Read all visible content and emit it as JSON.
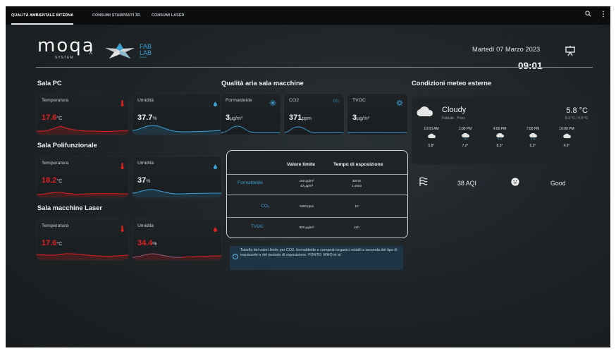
{
  "topbar": {
    "tabs": [
      {
        "label": "QUALITÀ AMBIENTALE INTERNA",
        "active": true
      },
      {
        "label": "CONSUMI STAMPANTI 3D",
        "active": false
      },
      {
        "label": "CONSUMI LASER",
        "active": false
      }
    ],
    "icons": [
      "search-icon",
      "more-vert-icon"
    ]
  },
  "header": {
    "logo_moqa": "moqa",
    "logo_system": "SYSTEM",
    "logo_x": "X",
    "fab_lab": "FAB\nLAB",
    "fab_sub": "trentino",
    "date": "Martedì 07 Marzo 2023",
    "time": "09:01"
  },
  "sala_pc": {
    "title": "Sala PC",
    "temperatura": {
      "label": "Temperatura",
      "value": "17.6",
      "unit": "°C"
    },
    "umidita": {
      "label": "Umidità",
      "value": "37.7",
      "unit": "%"
    }
  },
  "sala_polifunzionale": {
    "title": "Sala Polifunzionale",
    "temperatura": {
      "label": "Temperatura",
      "value": "18.2",
      "unit": "°C"
    },
    "umidita": {
      "label": "Umidità",
      "value": "37",
      "unit": "%"
    }
  },
  "sala_laser": {
    "title": "Sala macchine Laser",
    "temperatura": {
      "label": "Temperatura",
      "value": "17.6",
      "unit": "°C"
    },
    "umidita": {
      "label": "Umidità",
      "value": "34.4",
      "unit": "%"
    }
  },
  "aria": {
    "title": "Qualità aria sala macchine",
    "formaldeide": {
      "label": "Formaldeide",
      "value": "3",
      "unit": "μg/m³"
    },
    "co2": {
      "label": "CO2",
      "value": "371",
      "unit": "ppm",
      "badge": "CO₂"
    },
    "tvoc": {
      "label": "TVOC",
      "value": "3",
      "unit": "μg/m³"
    }
  },
  "limiti": {
    "header_valore": "Valore limite",
    "header_tempo": "Tempo di esposizione",
    "rows": [
      {
        "name": "Formaldeide",
        "valore1": "100 μg/m³",
        "valore2": "10 μg/m³",
        "tempo1": "30min",
        "tempo2": "1 anno"
      },
      {
        "name": "CO₂",
        "valore1": "1500 ppm",
        "tempo1": "1h"
      },
      {
        "name": "TVOC",
        "valore1": "600 μg/m³",
        "tempo1": "24h"
      }
    ],
    "note": "Tabella dei valori limite per CO2, formaldeide e composti organici volatili a seconda del tipo di inquinante e del periodo di esposizione. FONTE: WHO et al."
  },
  "meteo": {
    "title": "Condizioni meteo esterne",
    "condition": "Cloudy",
    "location": "FabLab - Povo",
    "temp": "5.8 °C",
    "range": "8.3 °C / 4.9 °C",
    "forecast": [
      {
        "time": "10:00 AM",
        "temp": "5.8°"
      },
      {
        "time": "1:00 PM",
        "temp": "7.2°"
      },
      {
        "time": "4:00 PM",
        "temp": "8.3°"
      },
      {
        "time": "7:00 PM",
        "temp": "6.3°"
      },
      {
        "time": "10:00 PM",
        "temp": "4.9°"
      }
    ],
    "aqi": "38 AQI",
    "aqi_status": "Good"
  },
  "colors": {
    "red": "#e02020",
    "blue": "#3aa2d6",
    "bg": "#1e2326"
  }
}
